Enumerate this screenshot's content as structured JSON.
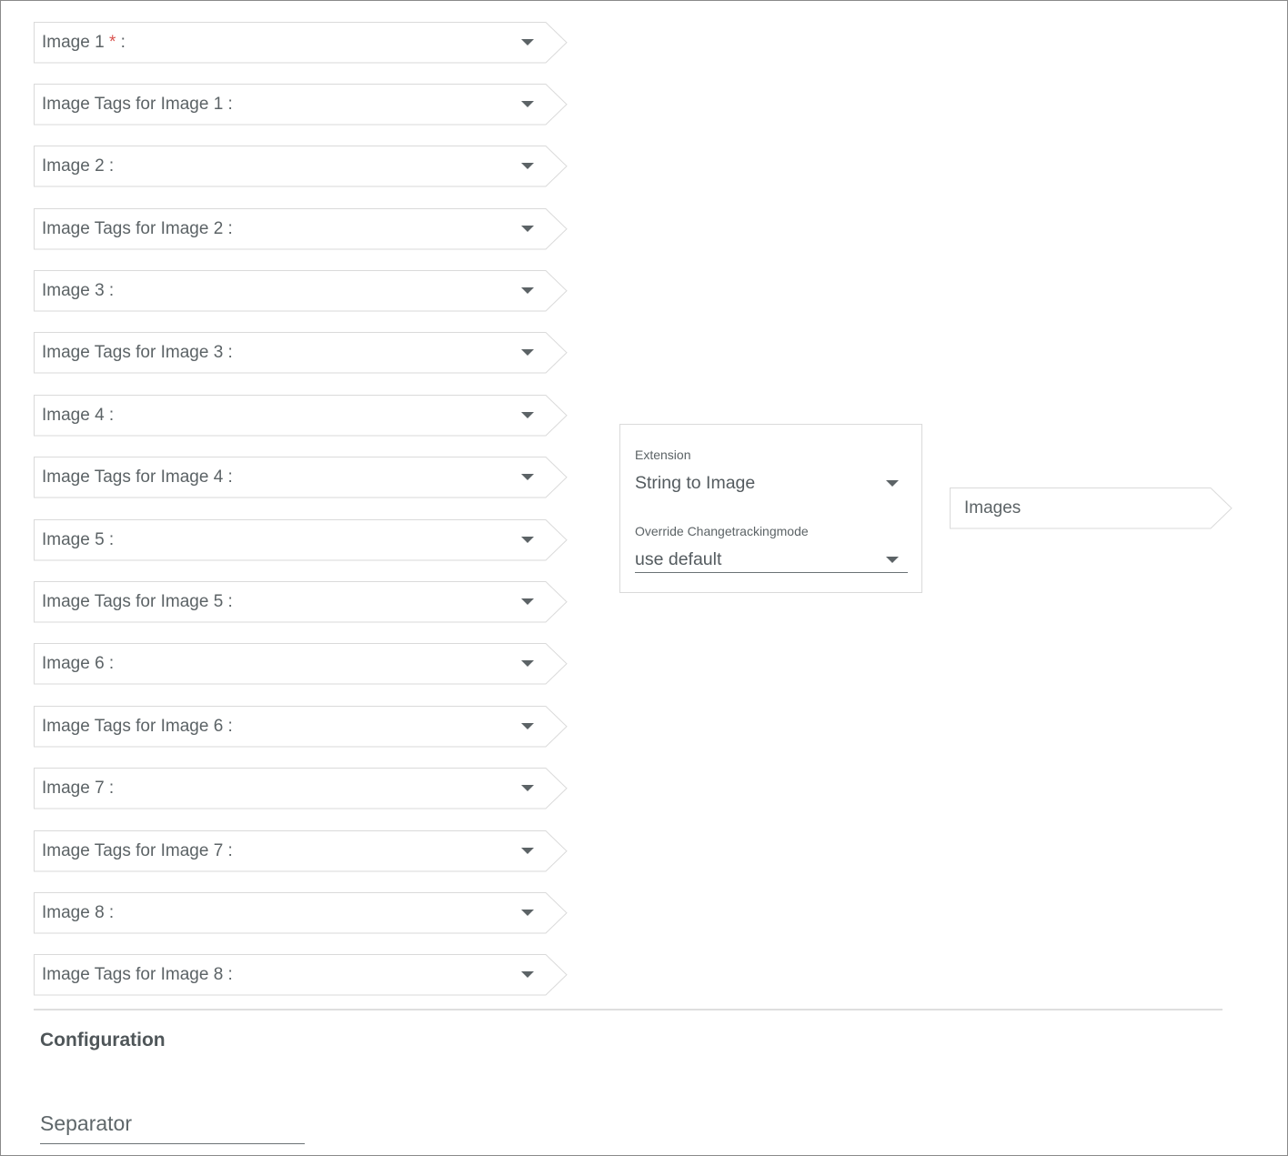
{
  "inputs": [
    {
      "label": "Image 1",
      "required": true,
      "suffix": " :"
    },
    {
      "label": "Image Tags for Image 1",
      "required": false,
      "suffix": " :"
    },
    {
      "label": "Image 2",
      "required": false,
      "suffix": " :"
    },
    {
      "label": "Image Tags for Image 2",
      "required": false,
      "suffix": " :"
    },
    {
      "label": "Image 3",
      "required": false,
      "suffix": " :"
    },
    {
      "label": "Image Tags for Image 3",
      "required": false,
      "suffix": " :"
    },
    {
      "label": "Image 4",
      "required": false,
      "suffix": " :"
    },
    {
      "label": "Image Tags for Image 4",
      "required": false,
      "suffix": " :"
    },
    {
      "label": "Image 5",
      "required": false,
      "suffix": " :"
    },
    {
      "label": "Image Tags for Image 5",
      "required": false,
      "suffix": " :"
    },
    {
      "label": "Image 6",
      "required": false,
      "suffix": " :"
    },
    {
      "label": "Image Tags for Image 6",
      "required": false,
      "suffix": " :"
    },
    {
      "label": "Image 7",
      "required": false,
      "suffix": " :"
    },
    {
      "label": "Image Tags for Image 7",
      "required": false,
      "suffix": " :"
    },
    {
      "label": "Image 8",
      "required": false,
      "suffix": " :"
    },
    {
      "label": "Image Tags for Image 8",
      "required": false,
      "suffix": " :"
    }
  ],
  "required_marker": "*",
  "extension_panel": {
    "extension_label": "Extension",
    "extension_value": "String to Image",
    "changetracking_label": "Override Changetrackingmode",
    "changetracking_value": "use default"
  },
  "output": {
    "label": "Images"
  },
  "configuration": {
    "title": "Configuration",
    "separator_placeholder": "Separator"
  },
  "colors": {
    "border": "#dadada",
    "text": "#5c6366",
    "required": "#d9534f"
  }
}
